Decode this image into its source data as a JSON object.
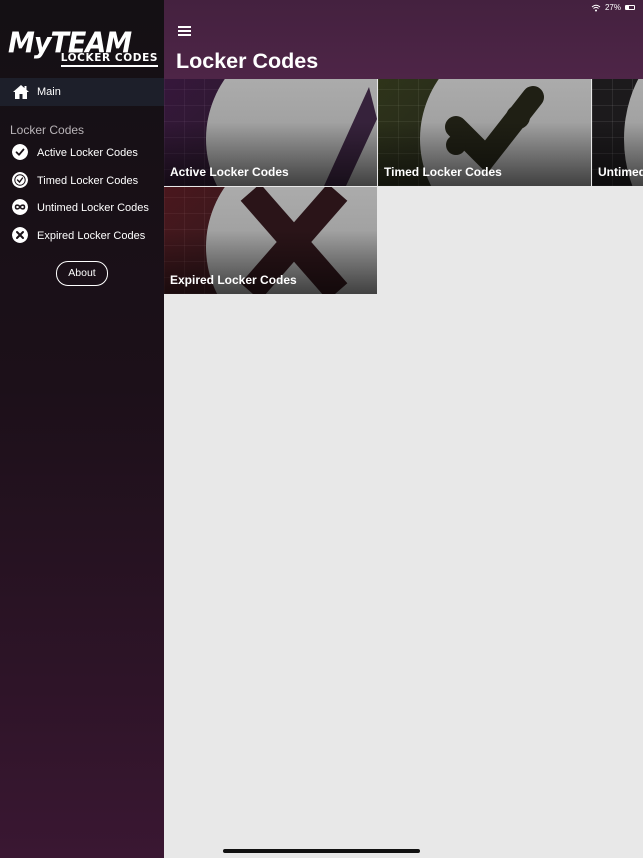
{
  "app": {
    "logo_main": "MyTEAM",
    "logo_sub": "LOCKER CODES"
  },
  "status_bar": {
    "battery_text": "27%"
  },
  "sidebar": {
    "main_label": "Main",
    "section_title": "Locker Codes",
    "items": [
      {
        "label": "Active Locker Codes",
        "icon": "check-circle-icon"
      },
      {
        "label": "Timed Locker Codes",
        "icon": "clock-icon"
      },
      {
        "label": "Untimed Locker Codes",
        "icon": "infinity-icon"
      },
      {
        "label": "Expired Locker Codes",
        "icon": "x-circle-icon"
      }
    ],
    "about_label": "About"
  },
  "header": {
    "title": "Locker Codes"
  },
  "tiles": [
    {
      "label": "Active Locker Codes"
    },
    {
      "label": "Timed Locker Codes"
    },
    {
      "label": "Untimed Locker Codes"
    },
    {
      "label": "Expired Locker Codes"
    }
  ],
  "colors": {
    "header": "#4a2344",
    "sidebar_top": "#141014",
    "sidebar_bottom": "#3a1732",
    "content_bg": "#e8e8e8"
  }
}
